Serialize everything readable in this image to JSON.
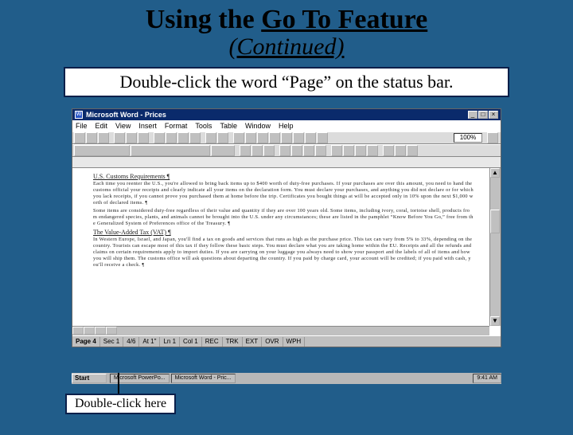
{
  "slide": {
    "title_prefix": "Using the ",
    "title_underlined": "Go To Feature",
    "subtitle_open": "(",
    "subtitle_underlined": "Continued)",
    "instruction": "Double-click the word “Page” on the status bar.",
    "callout": "Double-click here"
  },
  "word": {
    "titlebar": {
      "icon_letter": "W",
      "app": "Microsoft Word - Prices"
    },
    "window_controls": {
      "min": "_",
      "max": "□",
      "close": "×"
    },
    "menus": [
      "File",
      "Edit",
      "View",
      "Insert",
      "Format",
      "Tools",
      "Table",
      "Window",
      "Help"
    ],
    "zoom": "100%",
    "doc": {
      "h1": "U.S. Customs Requirements ¶",
      "p1": "Each time you reenter the U.S., you're allowed to bring back items up to $400 worth of duty-free purchases. If your purchases are over this amount, you need to hand the customs official your receipts and clearly indicate all your items on the declaration form. You must declare your purchases, and anything you did not declare or for which you lack receipts, if you cannot prove you purchased them at home before the trip. Certificates you bought things at will be accepted only in 10% upon the next $1,000 worth of declared items. ¶",
      "p2": "Some items are considered duty-free regardless of their value and quantity if they are over 100 years old. Some items, including ivory, coral, tortoise shell, products from endangered species, plants, and animals cannot be brought into the U.S. under any circumstances; these are listed in the pamphlet “Know Before You Go,” free from the Generalized System of Preferences office of the Treasury. ¶",
      "h2": "The Value-Added Tax (VAT) ¶",
      "p3": "In Western Europe, Israel, and Japan, you'll find a tax on goods and services that runs as high as the purchase price. This tax can vary from 5% to 33%, depending on the country. Tourists can escape most of this tax if they follow these basic steps. You must declare what you are taking home within the EU. Receipts and all the refunds and claims on certain requirements apply to import duties. If you are carrying on your luggage you always need to show your passport and the labels of all of items and how you will ship them. The customs office will ask questions about departing the country. If you paid by charge card, your account will be credited; if you paid with cash, you'll receive a check. ¶"
    },
    "statusbar": {
      "page": "Page 4",
      "sec": "Sec 1",
      "pages": "4/6",
      "at": "At 1\"",
      "ln": "Ln 1",
      "col": "Col 1",
      "modes": [
        "REC",
        "TRK",
        "EXT",
        "OVR",
        "WPH"
      ]
    },
    "taskbar": {
      "start": "Start",
      "items": [
        "Microsoft PowerPo...",
        "Microsoft Word - Pric..."
      ],
      "clock": "9:41 AM"
    }
  }
}
